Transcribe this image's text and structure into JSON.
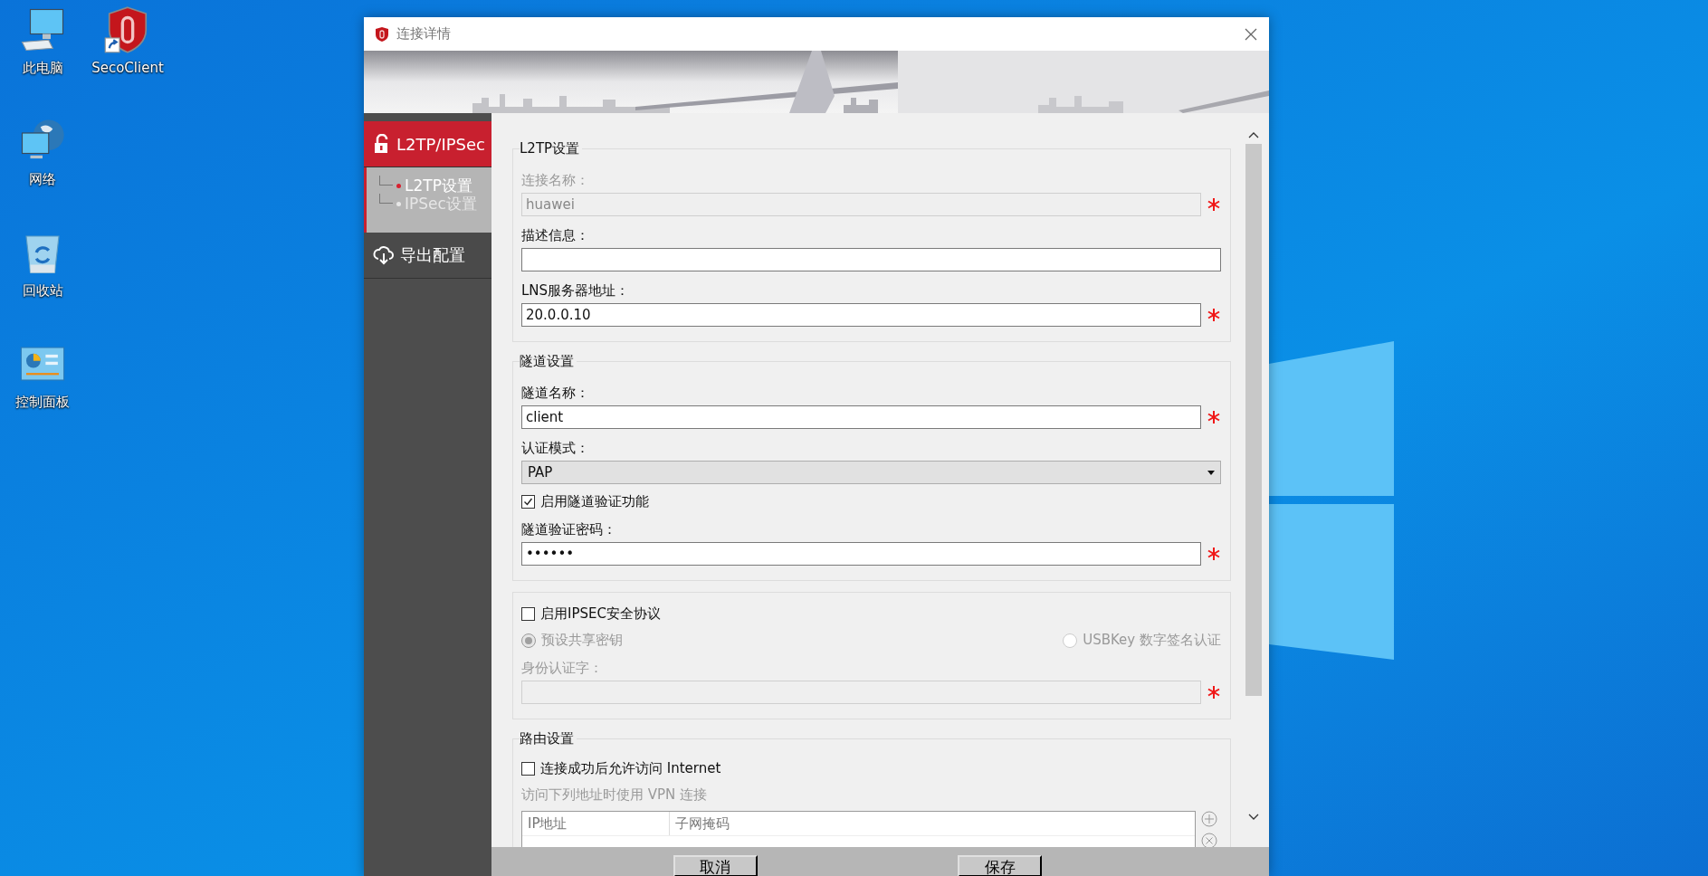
{
  "desktop_icons": [
    {
      "label": "此电脑",
      "kind": "computer"
    },
    {
      "label": "网络",
      "kind": "network"
    },
    {
      "label": "回收站",
      "kind": "recycle"
    },
    {
      "label": "控制面板",
      "kind": "control"
    },
    {
      "label": "SecoClient",
      "kind": "shortcut"
    }
  ],
  "dialog": {
    "title": "连接详情"
  },
  "nav": [
    {
      "label": "L2TP/IPSec",
      "kind": "lock",
      "selected": true,
      "children": [
        {
          "label": "L2TP设置",
          "selected": true
        },
        {
          "label": "IPSec设置",
          "selected": false
        }
      ]
    },
    {
      "label": "导出配置",
      "kind": "export",
      "selected": false
    }
  ],
  "sections": [
    {
      "title": "L2TP设置",
      "rows": [
        {
          "kind": "field",
          "label": "连接名称：",
          "value": "huawei",
          "required": true,
          "disabled": true
        },
        {
          "kind": "field",
          "label": "描述信息：",
          "required": false,
          "disabled": false
        },
        {
          "kind": "field",
          "label": "LNS服务器地址：",
          "value": "20.0.0.10",
          "required": true,
          "disabled": false
        }
      ]
    },
    {
      "title": "隧道设置",
      "rows": [
        {
          "kind": "field",
          "label": "隧道名称：",
          "value": "client",
          "required": true,
          "disabled": false
        },
        {
          "kind": "select",
          "label": "认证模式：",
          "value": "PAP"
        },
        {
          "kind": "checkbox",
          "label": "启用隧道验证功能",
          "checked": true
        },
        {
          "kind": "field",
          "label": "隧道验证密码：",
          "value": "••••••",
          "required": true,
          "disabled": false
        }
      ]
    },
    {
      "rows": [
        {
          "kind": "checkbox",
          "label": "启用IPSEC安全协议",
          "checked": false
        },
        {
          "kind": "radios",
          "disabled": true,
          "options": [
            {
              "label": "预设共享密钥",
              "selected": true
            },
            {
              "label": "USBKey 数字签名认证",
              "selected": false
            }
          ]
        },
        {
          "kind": "field",
          "label": "身份认证字：",
          "required": true,
          "disabled": true
        }
      ]
    },
    {
      "title": "路由设置",
      "rows": [
        {
          "kind": "checkbox",
          "label": "连接成功后允许访问 Internet",
          "checked": false
        },
        {
          "kind": "note",
          "text": "访问下列地址时使用 VPN 连接"
        },
        {
          "kind": "table",
          "columns": [
            "IP地址",
            "子网掩码"
          ]
        }
      ]
    }
  ],
  "buttons": [
    "取消",
    "保存"
  ]
}
